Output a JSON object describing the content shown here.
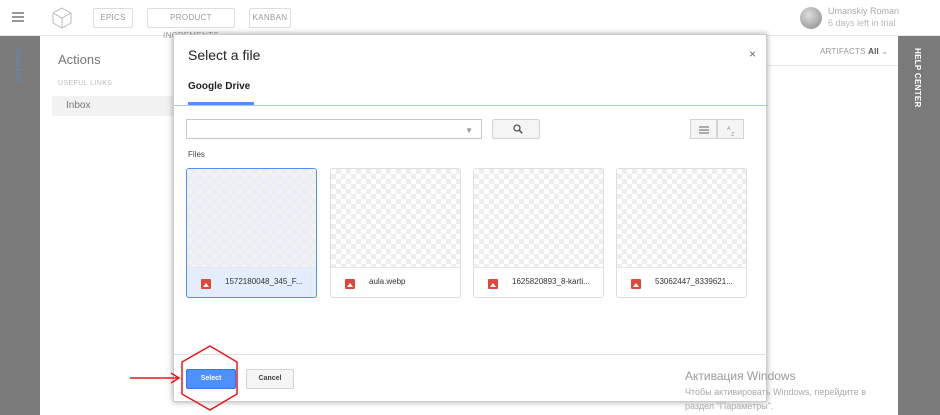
{
  "topbar": {
    "tabs": [
      "EPICS",
      "PRODUCT INCREMENTS",
      "KANBAN"
    ],
    "user_name": "Umanskiy Roman",
    "trial": "6 days left in trial"
  },
  "left_panel": {
    "vertical_label": "ACTIONS",
    "title": "Actions",
    "section": "USEFUL LINKS",
    "items": [
      "Inbox"
    ]
  },
  "right_panel": {
    "artifacts_prefix": "ARTIFACTS",
    "artifacts_value": "All",
    "help_center": "HELP CENTER"
  },
  "dialog": {
    "title": "Select a file",
    "close": "×",
    "tab": "Google Drive",
    "search_placeholder": "",
    "files_label": "Files",
    "files": [
      {
        "name": "1572180048_345_F..."
      },
      {
        "name": "aula.webp"
      },
      {
        "name": "1625820893_8-karti..."
      },
      {
        "name": "53062447_8339621..."
      }
    ],
    "select_label": "Select",
    "cancel_label": "Cancel"
  },
  "windows_watermark": {
    "line1": "Активация Windows",
    "line2": "Чтобы активировать Windows, перейдите в",
    "line3": "раздел \"Параметры\"."
  },
  "colors": {
    "accent": "#4d90fe",
    "annotation": "#e8161c",
    "sidebar": "#7a7a7a"
  }
}
